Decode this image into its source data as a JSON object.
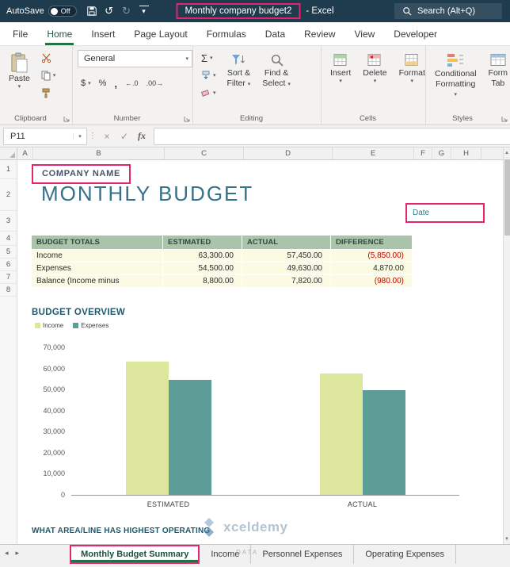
{
  "colors": {
    "titlebar": "#1f3b4e",
    "annotation": "#e3256d",
    "table_header_bg": "#a9c4ab",
    "table_row_bg": "#fbfae3",
    "negative_text": "#c00000",
    "accent_teal": "#35718a",
    "active_tab_underline": "#217346"
  },
  "title_bar": {
    "autosave_label": "AutoSave",
    "autosave_state": "Off",
    "doc_title": "Monthly company budget2",
    "app_suffix": "- Excel",
    "search_text": "Search (Alt+Q)"
  },
  "menu_tabs": [
    "File",
    "Home",
    "Insert",
    "Page Layout",
    "Formulas",
    "Data",
    "Review",
    "View",
    "Developer"
  ],
  "active_menu_tab": "Home",
  "ribbon": {
    "clipboard": {
      "group_label": "Clipboard",
      "paste_label": "Paste"
    },
    "number": {
      "group_label": "Number",
      "format_value": "General",
      "currency": "$",
      "percent": "%",
      "comma": ","
    },
    "editing": {
      "group_label": "Editing",
      "sort_filter_line1": "Sort &",
      "sort_filter_line2": "Filter",
      "find_select_line1": "Find &",
      "find_select_line2": "Select"
    },
    "cells": {
      "group_label": "Cells",
      "insert_label": "Insert",
      "delete_label": "Delete",
      "format_label": "Format"
    },
    "styles": {
      "group_label": "Styles",
      "conditional_line1": "Conditional",
      "conditional_line2": "Formatting",
      "format_table_line1": "Form",
      "format_table_line2": "Tab"
    }
  },
  "formula_bar": {
    "name_box": "P11",
    "fx": "fx",
    "formula_value": ""
  },
  "grid": {
    "columns": [
      "A",
      "B",
      "C",
      "D",
      "E",
      "F",
      "G",
      "H"
    ],
    "row_numbers": [
      "1",
      "2",
      "3",
      "4",
      "5",
      "6",
      "7",
      "8"
    ]
  },
  "sheet": {
    "company_name": "COMPANY NAME",
    "main_title": "MONTHLY BUDGET",
    "date_label": "Date",
    "table": {
      "headers": [
        "BUDGET TOTALS",
        "ESTIMATED",
        "ACTUAL",
        "DIFFERENCE"
      ],
      "rows": [
        {
          "label": "Income",
          "estimated": "63,300.00",
          "actual": "57,450.00",
          "difference": "(5,850.00)",
          "diff_negative": true
        },
        {
          "label": "Expenses",
          "estimated": "54,500.00",
          "actual": "49,630.00",
          "difference": "4,870.00",
          "diff_negative": false
        },
        {
          "label": "Balance (Income minus",
          "estimated": "8,800.00",
          "actual": "7,820.00",
          "difference": "(980.00)",
          "diff_negative": true
        }
      ]
    },
    "overview_title": "BUDGET OVERVIEW",
    "bottom_text": "WHAT AREA/LINE HAS HIGHEST OPERATING",
    "watermark_text": "xceldemy",
    "watermark_sub": "DATA"
  },
  "chart_data": {
    "type": "bar",
    "title": "BUDGET OVERVIEW",
    "categories": [
      "ESTIMATED",
      "ACTUAL"
    ],
    "series": [
      {
        "name": "Income",
        "values": [
          63300,
          57450
        ],
        "color": "#dce79d"
      },
      {
        "name": "Expenses",
        "values": [
          54500,
          49630
        ],
        "color": "#5d9d98"
      }
    ],
    "ylim": [
      0,
      70000
    ],
    "ytick_labels": [
      "70,000",
      "60,000",
      "50,000",
      "40,000",
      "30,000",
      "20,000",
      "10,000",
      "0"
    ],
    "legend_position": "top-left",
    "grid": false
  },
  "sheet_tabs": {
    "tabs": [
      "Monthly Budget Summary",
      "Income",
      "Personnel Expenses",
      "Operating Expenses"
    ],
    "active": "Monthly Budget Summary"
  },
  "icons": {
    "dropdown": "▾",
    "undo": "↺",
    "redo": "↻",
    "sigma": "Σ",
    "increase_decimal": "←.0",
    "decrease_decimal": ".00→",
    "close": "×",
    "check": "✓",
    "divider_dots": "⋮",
    "nav_left": "◂",
    "nav_right": "▸",
    "scroll_up": "▲",
    "scroll_down": "▼"
  }
}
